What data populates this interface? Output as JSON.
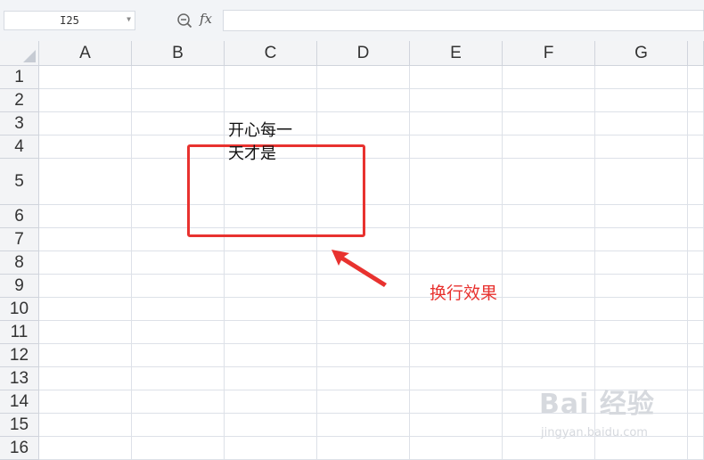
{
  "formula_bar": {
    "name_box": "I25",
    "fx_label": "fx",
    "formula_value": ""
  },
  "columns": [
    "A",
    "B",
    "C",
    "D",
    "E",
    "F",
    "G"
  ],
  "rows": [
    "1",
    "2",
    "3",
    "4",
    "5",
    "6",
    "7",
    "8",
    "9",
    "10",
    "11",
    "12",
    "13",
    "14",
    "15",
    "16"
  ],
  "cell_c5": {
    "line1": "开心每一",
    "line2": "天才是"
  },
  "annotation": {
    "text": "换行效果",
    "color": "#e8322f"
  },
  "watermark": {
    "main": "Bai 经验",
    "sub": "jingyan.baidu.com"
  },
  "colors": {
    "header_bg": "#f3f4f6",
    "grid_line": "#dde1e8",
    "accent_red": "#e8322f"
  }
}
